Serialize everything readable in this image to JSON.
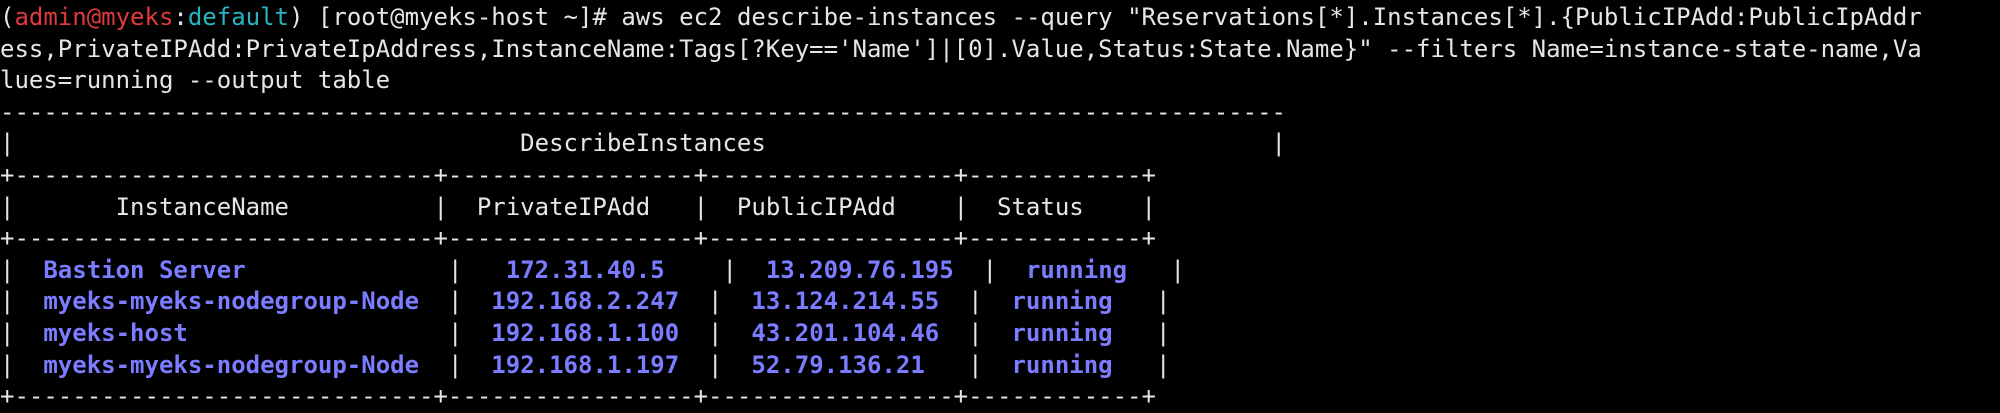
{
  "prompt": {
    "open_paren": "(",
    "user": "admin@myeks",
    "colon": ":",
    "context": "default",
    "close_paren": ")",
    "shell": " [root@myeks-host ~]# "
  },
  "command": {
    "line1": "aws ec2 describe-instances --query \"Reservations[*].Instances[*].{PublicIPAdd:PublicIpAddr",
    "line2": "ess,PrivateIPAdd:PrivateIpAddress,InstanceName:Tags[?Key=='Name']|[0].Value,Status:State.Name}\" --filters Name=instance-state-name,Va",
    "line3": "lues=running --output table"
  },
  "table": {
    "rule_top": "-----------------------------------------------------------------------------------------",
    "title_line": "|                                   DescribeInstances                                   |",
    "rule_sep": "+-----------------------------+-----------------+-----------------+------------+",
    "columns": {
      "name": "InstanceName",
      "private": "PrivateIPAdd",
      "public": "PublicIPAdd",
      "status": "Status"
    },
    "rows": [
      {
        "name": "Bastion Server",
        "private": "172.31.40.5",
        "public": "13.209.76.195",
        "status": "running"
      },
      {
        "name": "myeks-myeks-nodegroup-Node",
        "private": "192.168.2.247",
        "public": "13.124.214.55",
        "status": "running"
      },
      {
        "name": "myeks-host",
        "private": "192.168.1.100",
        "public": "43.201.104.46",
        "status": "running"
      },
      {
        "name": "myeks-myeks-nodegroup-Node",
        "private": "192.168.1.197",
        "public": "52.79.136.21",
        "status": "running"
      }
    ]
  },
  "colors": {
    "background": "#000000",
    "user": "#e03a3a",
    "context": "#25b6c0",
    "table_values": "#7b7cff",
    "text": "#e6e6e6"
  }
}
